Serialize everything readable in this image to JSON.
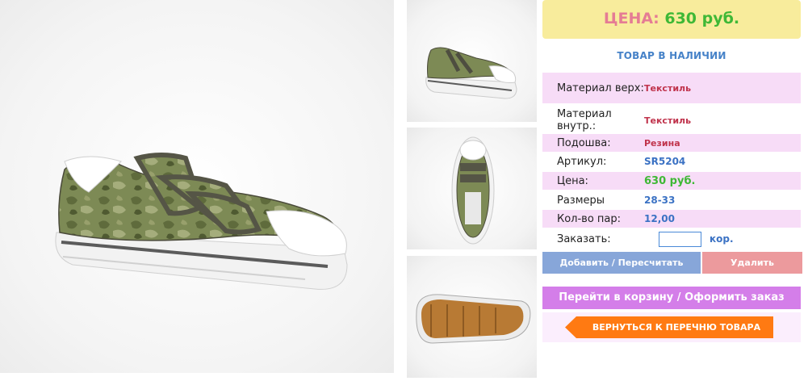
{
  "product": {
    "price_label": "ЦЕНА:",
    "price_value": "630 руб.",
    "stock_status": "ТОВАР В НАЛИЧИИ"
  },
  "specs": [
    {
      "label": "Материал верх:",
      "value": "Текстиль"
    },
    {
      "label": "Материал внутр.:",
      "value": "Текстиль"
    },
    {
      "label": "Подошва:",
      "value": "Резина"
    },
    {
      "label": "Артикул:",
      "value": "SR5204"
    },
    {
      "label": "Цена:",
      "value": "630 руб."
    },
    {
      "label": "Размеры",
      "value": "28-33"
    },
    {
      "label": "Кол-во пар:",
      "value": "12,00"
    }
  ],
  "order": {
    "label": "Заказать:",
    "quantity_value": "",
    "unit": "кор."
  },
  "buttons": {
    "add": "Добавить / Пересчитать",
    "delete": "Удалить",
    "cart": "Перейти в корзину / Оформить заказ",
    "back": "ВЕРНУТЬСЯ К ПЕРЕЧНЮ ТОВАРА"
  },
  "colors": {
    "price_box": "#f8ec9c",
    "price_label": "#e57c94",
    "price_value": "#3fb836",
    "row_highlight": "#f7dcf7",
    "add_button": "#87a6d9",
    "delete_button": "#ec9a9d",
    "cart_button": "#d47ee9",
    "back_button": "#ff7a12"
  }
}
